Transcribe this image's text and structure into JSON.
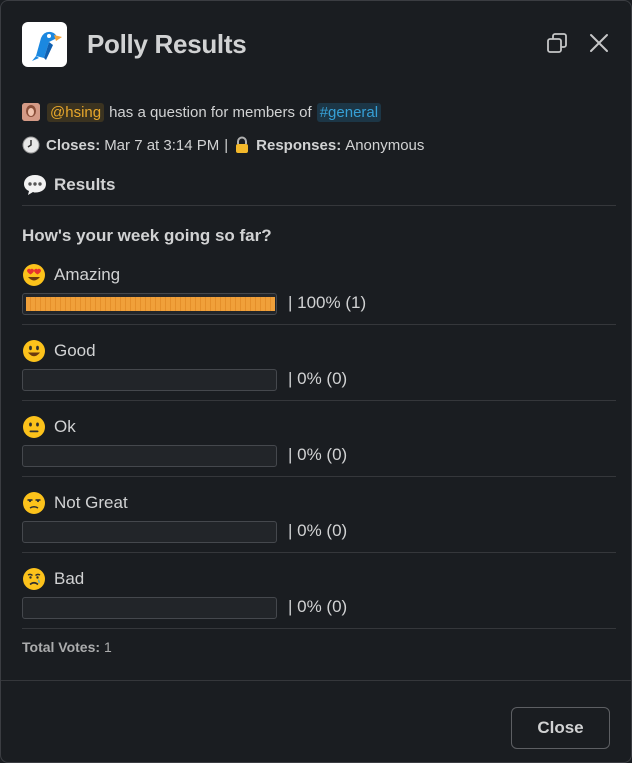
{
  "modal": {
    "title": "Polly Results",
    "close_button": "Close"
  },
  "meta": {
    "mention": "@hsing",
    "question_text": "has a question for members of",
    "channel": "#general",
    "closes_label": "Closes:",
    "closes_value": "Mar 7 at 3:14 PM",
    "separator": "|",
    "responses_label": "Responses:",
    "responses_value": "Anonymous"
  },
  "results": {
    "heading": "Results",
    "question": "How's your week going so far?",
    "options": [
      {
        "emoji": "heart-eyes",
        "label": "Amazing",
        "percent": 100,
        "votes": 1,
        "display": "|  100% (1)"
      },
      {
        "emoji": "smiley",
        "label": "Good",
        "percent": 0,
        "votes": 0,
        "display": "|  0% (0)"
      },
      {
        "emoji": "neutral",
        "label": "Ok",
        "percent": 0,
        "votes": 0,
        "display": "|  0% (0)"
      },
      {
        "emoji": "unamused",
        "label": "Not Great",
        "percent": 0,
        "votes": 0,
        "display": "|  0% (0)"
      },
      {
        "emoji": "cry",
        "label": "Bad",
        "percent": 0,
        "votes": 0,
        "display": "|  0% (0)"
      }
    ],
    "total_label": "Total Votes:",
    "total_value": "1"
  },
  "colors": {
    "background": "#1a1d21",
    "bar_fill": "#f0a03a",
    "mention": "#e8a72b",
    "channel": "#36a0d6"
  }
}
